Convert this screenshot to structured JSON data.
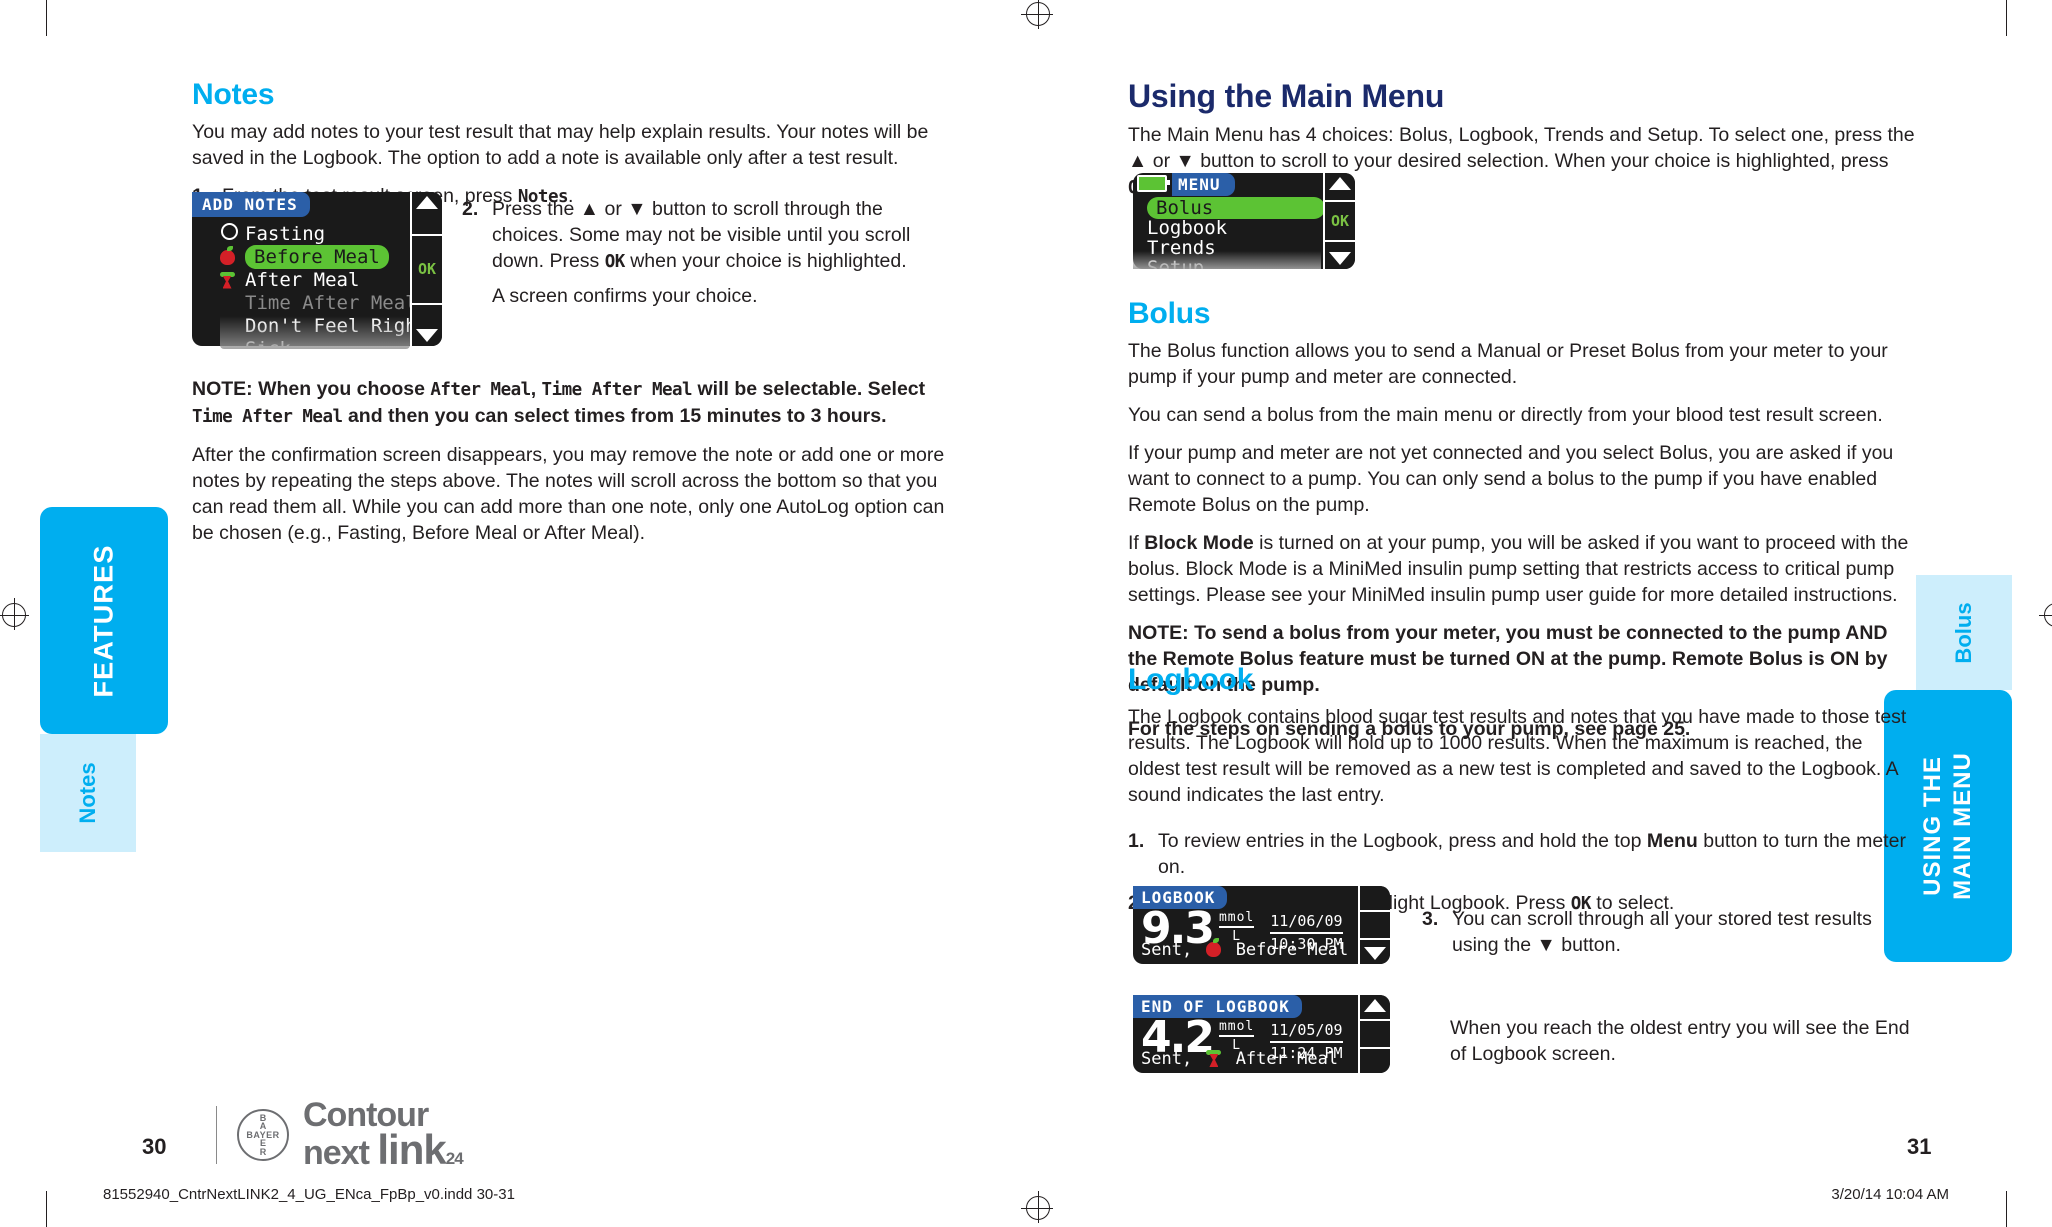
{
  "left_page": {
    "number": "30",
    "heading": "Notes",
    "intro": "You may add notes to your test result that may help explain results. Your notes will be saved in the Logbook. The option to add a note is available only after a test result.",
    "step1": {
      "num": "1.",
      "text_before": "From the test result screen, press ",
      "mono": "Notes",
      "text_after": "."
    },
    "step2": {
      "num": "2.",
      "line1": "Press the ▲ or ▼ button to scroll through the choices. Some may not be visible until you scroll down. Press ",
      "mono": "OK",
      "line2": " when your choice is highlighted.",
      "line3": "A screen confirms your choice."
    },
    "note": {
      "prefix": "NOTE: When you choose ",
      "mono1": "After Meal",
      "mid1": ", ",
      "mono2": "Time After Meal",
      "mid2": " will be selectable. Select ",
      "mono3": "Time After Meal",
      "suffix": " and then you can select times from 15 minutes to 3 hours."
    },
    "after_note": "After the confirmation screen disappears, you may remove the note or add one or more notes by repeating the steps above. The notes will scroll across the bottom so that you can read them all. While you can add more than one note, only one AutoLog option can be chosen (e.g., Fasting, Before Meal or After Meal).",
    "add_notes_screen": {
      "title": "ADD NOTES",
      "ok_label": "OK",
      "items": [
        {
          "label": "Fasting",
          "icon": "circle-icon",
          "state": "normal"
        },
        {
          "label": "Before Meal",
          "icon": "apple-icon",
          "state": "selected"
        },
        {
          "label": "After Meal",
          "icon": "apple-core-icon",
          "state": "normal"
        },
        {
          "label": "Time After Meal",
          "icon": "none",
          "state": "dimmed"
        },
        {
          "label": "Don't Feel Right",
          "icon": "none",
          "state": "normal"
        },
        {
          "label": "Sick",
          "icon": "none",
          "state": "normal"
        }
      ]
    },
    "side_tabs": {
      "chapter": "FEATURES",
      "section": "Notes"
    }
  },
  "right_page": {
    "number": "31",
    "main_menu": {
      "heading": "Using the Main Menu",
      "intro_a": "The Main Menu has 4 choices: Bolus, Logbook, Trends and Setup. To select one, press the ▲ or ▼ button to scroll to your desired selection. When your choice is highlighted, press ",
      "intro_mono": "OK",
      "intro_b": ".",
      "screen": {
        "title": "MENU",
        "ok_label": "OK",
        "items": [
          {
            "label": "Bolus",
            "state": "selected"
          },
          {
            "label": "Logbook",
            "state": "normal"
          },
          {
            "label": "Trends",
            "state": "normal"
          },
          {
            "label": "Setup",
            "state": "normal"
          }
        ]
      }
    },
    "bolus": {
      "heading": "Bolus",
      "p1": "The Bolus function allows you to send a Manual or Preset Bolus from your meter to your pump if your pump and meter are connected.",
      "p2": "You can send a bolus from the main menu or directly from your blood test result screen.",
      "p3": "If your pump and meter are not yet connected and you select Bolus, you are asked if you want to connect to a pump. You can only send a bolus to the pump if you have enabled Remote Bolus on the pump.",
      "p4_a": "If ",
      "p4_bold": "Block Mode",
      "p4_b": " is turned on at your pump, you will be asked if you want to proceed with the bolus. Block Mode is a MiniMed insulin pump setting that restricts access to critical pump settings. Please see your MiniMed insulin pump user guide for more detailed instructions.",
      "note": "NOTE: To send a bolus from your meter, you must be connected to the pump AND the Remote Bolus feature must be turned ON at the pump. Remote Bolus is ON by default on the pump.",
      "see_page": "For the steps on sending a bolus to your pump, see page 25."
    },
    "logbook": {
      "heading": "Logbook",
      "p1": "The Logbook contains blood sugar test results and notes that you have made to those test results. The Logbook will hold up to 1000 results. When the maximum is reached, the oldest test result will be removed as a new test is completed and saved to the Logbook. A sound indicates the last entry.",
      "step1": {
        "num": "1.",
        "a": "To review entries in the Logbook, press and hold the top ",
        "bold": "Menu",
        "b": " button to turn the meter on."
      },
      "step2": {
        "num": "2.",
        "a": "Press the ▼ button to highlight Logbook. Press ",
        "mono": "OK",
        "b": " to select."
      },
      "step3": {
        "num": "3.",
        "text": "You can scroll through all your stored test results using the ▼ button."
      },
      "end_text": "When you reach the oldest entry you will see the End of Logbook screen.",
      "screen1": {
        "title": "LOGBOOK",
        "value": "9.3",
        "unit_top": "mmol",
        "unit_bottom": "L",
        "date": "11/06/09",
        "time": "10:30 PM",
        "footer_prefix": "Sent,",
        "footer_note": "Before Meal",
        "footer_icon": "apple-icon"
      },
      "screen2": {
        "title": "END OF LOGBOOK",
        "value": "4.2",
        "unit_top": "mmol",
        "unit_bottom": "L",
        "date": "11/05/09",
        "time": "11:24 PM",
        "footer_prefix": "Sent,",
        "footer_note": "After Meal",
        "footer_icon": "apple-core-icon"
      }
    },
    "side_tabs": {
      "chapter": "USING THE\nMAIN MENU",
      "section": "Bolus"
    }
  },
  "footer": {
    "logo": {
      "bayer_h": "BAYER",
      "bayer_v": [
        "B",
        "A",
        "Y",
        "E",
        "R"
      ],
      "line1": "Contour",
      "line2_a": "next",
      "line2_b": "link",
      "line2_sub": "24"
    },
    "file_meta": "81552940_CntrNextLINK2_4_UG_ENca_FpBp_v0.indd   30-31",
    "date_meta": "3/20/14   10:04 AM"
  },
  "colors": {
    "brand_cyan": "#00aeef",
    "tab_light": "#cdeefc",
    "navy_heading": "#1b2a6b",
    "meter_bg": "#1a1a1a",
    "highlight_green": "#5cc334",
    "ok_green": "#7ac143",
    "title_blue": "#2b5fa8",
    "body_text": "#231f20"
  }
}
